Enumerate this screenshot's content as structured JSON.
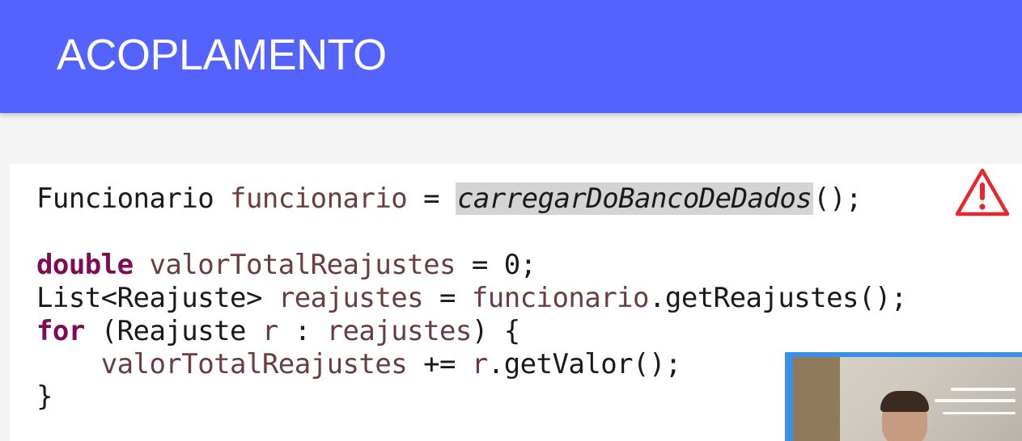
{
  "slide": {
    "title": "ACOPLAMENTO"
  },
  "code": {
    "line1": {
      "type": "Funcionario",
      "var": "funcionario",
      "assign": " = ",
      "call": "carregarDoBancoDeDados",
      "tail": "();"
    },
    "line2": {
      "kw": "double",
      "var": "valorTotalReajustes",
      "tail": " = 0;"
    },
    "line3": {
      "type": "List<Reajuste>",
      "var": "reajustes",
      "assign": " = ",
      "field": "funcionario",
      "tail": ".getReajustes();"
    },
    "line4": {
      "kw": "for",
      "open": " (Reajuste ",
      "var_r": "r",
      "colon": " : ",
      "var_list": "reajustes",
      "tail": ") {"
    },
    "line5": {
      "indent": "    ",
      "var": "valorTotalReajustes",
      "op": " += ",
      "var_r": "r",
      "tail": ".getValor();"
    },
    "line6": {
      "tail": "}"
    }
  },
  "icons": {
    "warning": "warning-triangle-icon"
  },
  "colors": {
    "header": "#5563fe",
    "keyword": "#7f0b55",
    "variable": "#6a3e3e",
    "warning": "#e8262b"
  }
}
